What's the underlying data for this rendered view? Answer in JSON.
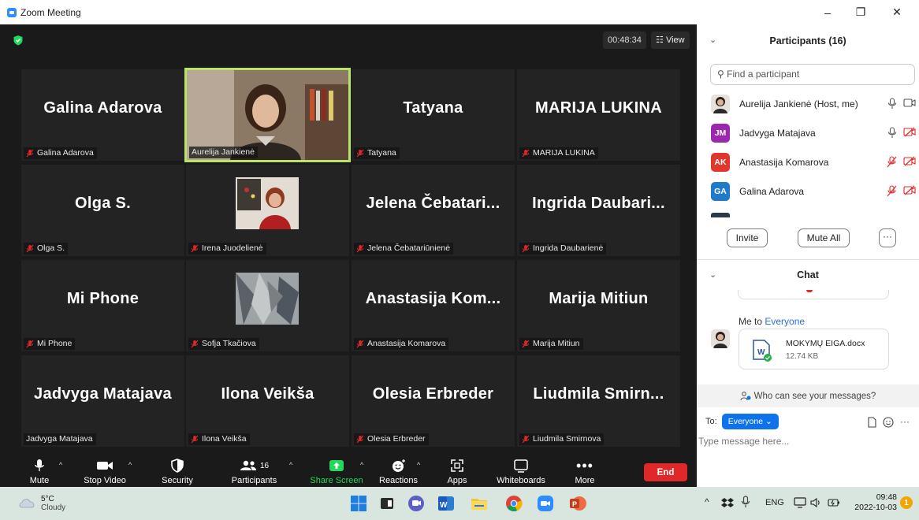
{
  "window": {
    "title": "Zoom Meeting",
    "minimize_glyph": "–",
    "restore_glyph": "❐",
    "close_glyph": "✕"
  },
  "meeting": {
    "timer": "00:48:34",
    "view_label": "View",
    "tiles": [
      {
        "name": "Galina Adarova",
        "label": "Galina Adarova",
        "muted": true
      },
      {
        "name": "",
        "label": "Aurelija Jankienė",
        "muted": false,
        "video": true
      },
      {
        "name": "Tatyana",
        "label": "Tatyana",
        "muted": true
      },
      {
        "name": "MARIJA  LUKINA",
        "label": "MARIJA  LUKINA",
        "muted": true
      },
      {
        "name": "Olga S.",
        "label": "Olga S.",
        "muted": true
      },
      {
        "name": "",
        "label": "Irena Juodelienė",
        "muted": true,
        "photo": true
      },
      {
        "name": "Jelena  Čebatari...",
        "label": "Jelena Čebatariūnienė",
        "muted": true
      },
      {
        "name": "Ingrida  Daubari...",
        "label": "Ingrida Daubarienė",
        "muted": true
      },
      {
        "name": "Mi Phone",
        "label": "Mi Phone",
        "muted": true
      },
      {
        "name": "",
        "label": "Sofja Tkačiova",
        "muted": true,
        "photo": true
      },
      {
        "name": "Anastasija  Kom...",
        "label": "Anastasija Komarova",
        "muted": true
      },
      {
        "name": "Marija Mitiun",
        "label": "Marija Mitiun",
        "muted": true
      },
      {
        "name": "Jadvyga Matajava",
        "label": "Jadvyga Matajava",
        "muted": false
      },
      {
        "name": "Ilona Veikša",
        "label": "Ilona Veikša",
        "muted": true
      },
      {
        "name": "Olesia Erbreder",
        "label": "Olesia Erbreder",
        "muted": true
      },
      {
        "name": "Liudmila  Smirn...",
        "label": "Liudmila Smirnova",
        "muted": true
      }
    ]
  },
  "toolbar": {
    "mute": "Mute",
    "stop_video": "Stop Video",
    "security": "Security",
    "participants": "Participants",
    "participants_count": "16",
    "share_screen": "Share Screen",
    "reactions": "Reactions",
    "apps": "Apps",
    "whiteboards": "Whiteboards",
    "more": "More",
    "end": "End"
  },
  "participants_panel": {
    "title": "Participants (16)",
    "search_placeholder": "Find a participant",
    "rows": [
      {
        "initials": "",
        "name": "Aurelija Jankienė (Host, me)",
        "color": "#8a7a6a"
      },
      {
        "initials": "JM",
        "name": "Jadvyga Matajava",
        "color": "#9b27b0"
      },
      {
        "initials": "AK",
        "name": "Anastasija Komarova",
        "color": "#e0362c"
      },
      {
        "initials": "GA",
        "name": "Galina Adarova",
        "color": "#1f7ac9"
      }
    ],
    "invite": "Invite",
    "mute_all": "Mute All",
    "more": "···"
  },
  "chat_panel": {
    "title": "Chat",
    "me_to_prefix": "Me to",
    "me_to_target": "Everyone",
    "file_name": "MOKYMŲ EIGA.docx",
    "file_size": "12.74 KB",
    "file_icon_letter": "W",
    "who_can_see": "Who can see your messages?",
    "to_label": "To:",
    "to_target": "Everyone ⌄",
    "placeholder": "Type message here..."
  },
  "taskbar": {
    "weather_temp": "5°C",
    "weather_desc": "Cloudy",
    "language": "ENG",
    "time": "09:48",
    "date": "2022-10-03",
    "notification_count": "1"
  },
  "colors": {
    "accent": "#0e72ed",
    "end": "#e02828",
    "active_border": "#b9e36a",
    "share_green": "#23d959"
  }
}
